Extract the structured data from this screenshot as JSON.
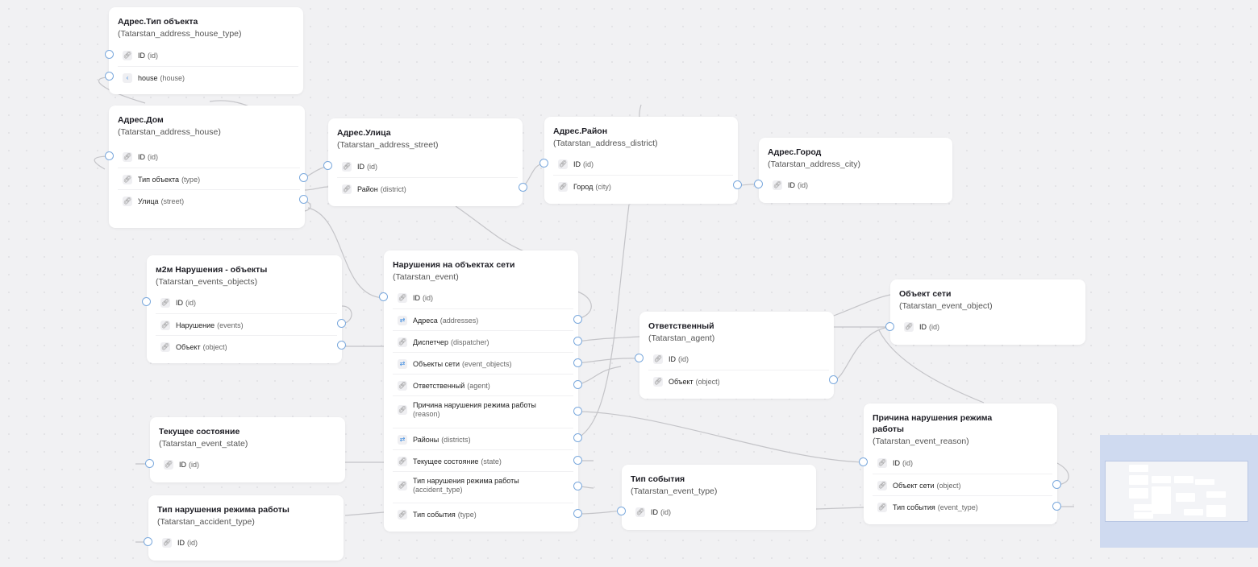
{
  "nodes": {
    "house_type": {
      "title": "Адрес.Тип объекта",
      "subtitle": "(Tatarstan_address_house_type)",
      "fields": [
        {
          "icon": "link-icon",
          "name": "ID",
          "key": "(id)"
        },
        {
          "icon": "relation-icon",
          "name": "house",
          "key": "(house)"
        }
      ]
    },
    "house": {
      "title": "Адрес.Дом",
      "subtitle": "(Tatarstan_address_house)",
      "fields": [
        {
          "icon": "link-icon",
          "name": "ID",
          "key": "(id)"
        },
        {
          "icon": "link-icon",
          "name": "Тип объекта",
          "key": "(type)"
        },
        {
          "icon": "link-icon",
          "name": "Улица",
          "key": "(street)"
        }
      ]
    },
    "street": {
      "title": "Адрес.Улица",
      "subtitle": "(Tatarstan_address_street)",
      "fields": [
        {
          "icon": "link-icon",
          "name": "ID",
          "key": "(id)"
        },
        {
          "icon": "link-icon",
          "name": "Район",
          "key": "(district)"
        }
      ]
    },
    "district": {
      "title": "Адрес.Район",
      "subtitle": "(Tatarstan_address_district)",
      "fields": [
        {
          "icon": "link-icon",
          "name": "ID",
          "key": "(id)"
        },
        {
          "icon": "link-icon",
          "name": "Город",
          "key": "(city)"
        }
      ]
    },
    "city": {
      "title": "Адрес.Город",
      "subtitle": "(Tatarstan_address_city)",
      "fields": [
        {
          "icon": "link-icon",
          "name": "ID",
          "key": "(id)"
        }
      ]
    },
    "events_objects": {
      "title": "м2м Нарушения - объекты",
      "subtitle": "(Tatarstan_events_objects)",
      "fields": [
        {
          "icon": "link-icon",
          "name": "ID",
          "key": "(id)"
        },
        {
          "icon": "link-icon",
          "name": "Нарушение",
          "key": "(events)"
        },
        {
          "icon": "link-icon",
          "name": "Объект",
          "key": "(object)"
        }
      ]
    },
    "event": {
      "title": "Нарушения на объектах сети",
      "subtitle": "(Tatarstan_event)",
      "fields": [
        {
          "icon": "link-icon",
          "name": "ID",
          "key": "(id)"
        },
        {
          "icon": "m2m-icon",
          "name": "Адреса",
          "key": "(addresses)"
        },
        {
          "icon": "link-icon",
          "name": "Диспетчер",
          "key": "(dispatcher)"
        },
        {
          "icon": "m2m-icon",
          "name": "Объекты сети",
          "key": "(event_objects)"
        },
        {
          "icon": "link-icon",
          "name": "Ответственный",
          "key": "(agent)"
        },
        {
          "icon": "link-icon",
          "name": "Причина нарушения режима работы",
          "key": "(reason)"
        },
        {
          "icon": "m2m-icon",
          "name": "Районы",
          "key": "(districts)"
        },
        {
          "icon": "link-icon",
          "name": "Текущее состояние",
          "key": "(state)"
        },
        {
          "icon": "link-icon",
          "name": "Тип нарушения режима работы",
          "key": "(accident_type)"
        },
        {
          "icon": "link-icon",
          "name": "Тип события",
          "key": "(type)"
        }
      ]
    },
    "agent": {
      "title": "Ответственный",
      "subtitle": "(Tatarstan_agent)",
      "fields": [
        {
          "icon": "link-icon",
          "name": "ID",
          "key": "(id)"
        },
        {
          "icon": "link-icon",
          "name": "Объект",
          "key": "(object)"
        }
      ]
    },
    "event_object": {
      "title": "Объект сети",
      "subtitle": "(Tatarstan_event_object)",
      "fields": [
        {
          "icon": "link-icon",
          "name": "ID",
          "key": "(id)"
        }
      ]
    },
    "event_state": {
      "title": "Текущее состояние",
      "subtitle": "(Tatarstan_event_state)",
      "fields": [
        {
          "icon": "link-icon",
          "name": "ID",
          "key": "(id)"
        }
      ]
    },
    "accident_type": {
      "title": "Тип нарушения режима работы",
      "subtitle": "(Tatarstan_accident_type)",
      "fields": [
        {
          "icon": "link-icon",
          "name": "ID",
          "key": "(id)"
        }
      ]
    },
    "event_type": {
      "title": "Тип события",
      "subtitle": "(Tatarstan_event_type)",
      "fields": [
        {
          "icon": "link-icon",
          "name": "ID",
          "key": "(id)"
        }
      ]
    },
    "event_reason": {
      "title": "Причина нарушения режима работы",
      "subtitle": "(Tatarstan_event_reason)",
      "fields": [
        {
          "icon": "link-icon",
          "name": "ID",
          "key": "(id)"
        },
        {
          "icon": "link-icon",
          "name": "Объект сети",
          "key": "(object)"
        },
        {
          "icon": "link-icon",
          "name": "Тип события",
          "key": "(event_type)"
        }
      ]
    }
  },
  "colors": {
    "edge": "#c4c4c8",
    "port_border": "#7ba9dd",
    "minimap": "#cfdaf0"
  }
}
